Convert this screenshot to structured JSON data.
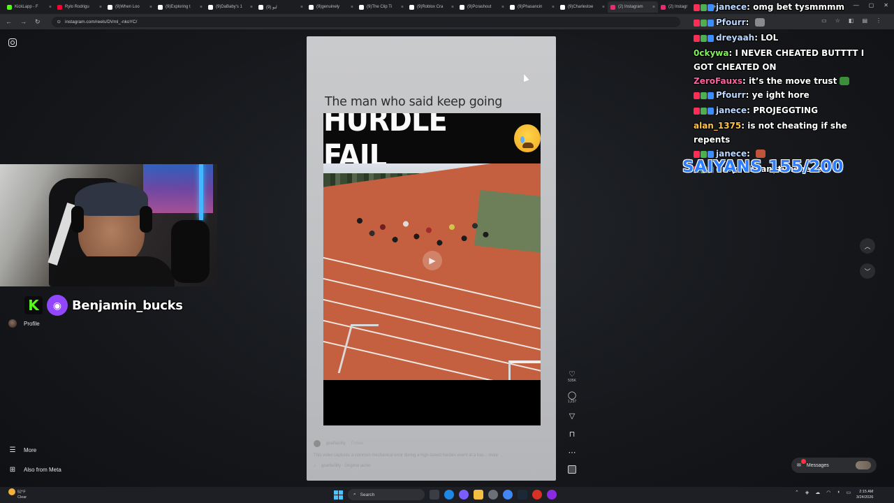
{
  "browser": {
    "tabs": [
      {
        "label": "KickLapp - F",
        "color": "#53fc18"
      },
      {
        "label": "Rylo Rodrigu",
        "color": "#ff0033"
      },
      {
        "label": "(9)When Loo",
        "color": "#ffffff"
      },
      {
        "label": "(9)Exploring t",
        "color": "#ffffff"
      },
      {
        "label": "(9)DaBaby's 1",
        "color": "#ffffff"
      },
      {
        "label": "ليو (9)",
        "color": "#ffffff"
      },
      {
        "label": "(9)genuinely",
        "color": "#ffffff"
      },
      {
        "label": "(9)The Clip Ti",
        "color": "#ffffff"
      },
      {
        "label": "(9)Roblox Cra",
        "color": "#ffffff"
      },
      {
        "label": "(9)Pcrashout",
        "color": "#ffffff"
      },
      {
        "label": "(9)Phasancin",
        "color": "#ffffff"
      },
      {
        "label": "(9)Charlestoe",
        "color": "#ffffff"
      },
      {
        "label": "(2) Instagram",
        "color": "#e1306c"
      },
      {
        "label": "(2) Instagr",
        "color": "#e1306c"
      }
    ],
    "url": "instagram.com/reels/DVml_-nkoYC/"
  },
  "instagram": {
    "rail": {
      "profile": "Profile",
      "more": "More",
      "also_from_meta": "Also from Meta"
    },
    "reel": {
      "title": "The man who said keep going",
      "caption_big": "HURDLE FAIL",
      "author": "goalfacility",
      "follow": "Follow",
      "description": "This video captures a common mechanical error during a high-speed hurdles event at a trac... more",
      "audio": "goalfacility · Original audio",
      "likes": "535K",
      "comments": "1,237"
    },
    "messages": "Messages"
  },
  "stream": {
    "streamer_name": "Benjamin_bucks",
    "chat": [
      {
        "user": "janece",
        "user_color": "#b9d7ff",
        "badges": true,
        "message": "omg bet tysmmmm"
      },
      {
        "user": "Pfourr",
        "user_color": "#b9d7ff",
        "badges": true,
        "message": "",
        "emote": true
      },
      {
        "user": "dreyaah",
        "user_color": "#b9d7ff",
        "badges": true,
        "message": "LOL"
      },
      {
        "user": "0ckywa",
        "user_color": "#7ff05a",
        "badges": false,
        "message": "I NEVER CHEATED BUTTTT I GOT CHEATED ON"
      },
      {
        "user": "ZeroFauxs",
        "user_color": "#ff5fa2",
        "badges": false,
        "message": "it’s the move trust",
        "emote": true
      },
      {
        "user": "Pfourr",
        "user_color": "#b9d7ff",
        "badges": true,
        "message": "ye ight hore"
      },
      {
        "user": "janece",
        "user_color": "#b9d7ff",
        "badges": true,
        "message": "PROJEGGTING"
      },
      {
        "user": "alan_1375",
        "user_color": "#ffc34a",
        "badges": false,
        "message": "is not cheating if she repents"
      },
      {
        "user": "janece",
        "user_color": "#b9d7ff",
        "badges": true,
        "message": "",
        "emote": true
      },
      {
        "user": "dreyaah",
        "user_color": "#b9d7ff",
        "badges": true,
        "message": "anytimeeeeee"
      }
    ],
    "goal": "SAIYANS 155/200"
  },
  "taskbar": {
    "weather_temp": "52°F",
    "weather_desc": "Clear",
    "search": "Search",
    "time": "2:15 AM",
    "date": "3/24/2026"
  }
}
